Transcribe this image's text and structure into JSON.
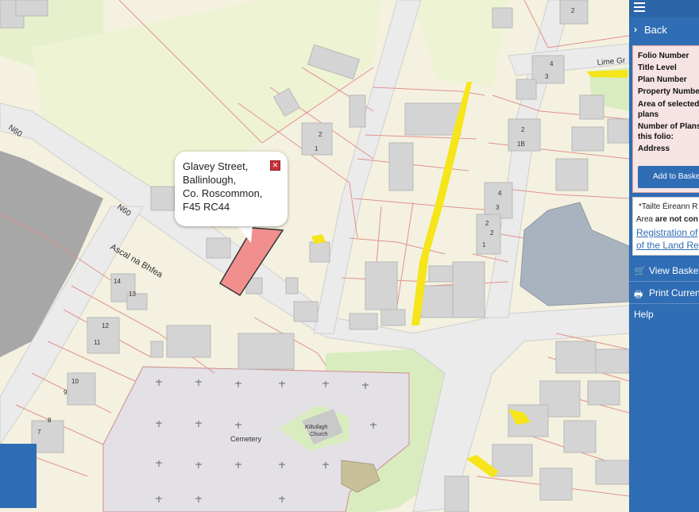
{
  "map": {
    "street_labels": {
      "n60_a": "N60",
      "n60_b": "N60",
      "ascal": "Ascal na Bhfea",
      "lime": "Lime Gr"
    },
    "building_labels": {
      "cemetery": "Cemetery",
      "church_line1": "Kiltullagh",
      "church_line2": "Church"
    },
    "house_numbers": [
      "2",
      "4",
      "3",
      "2",
      "1",
      "2",
      "1B",
      "4",
      "3",
      "2",
      "2",
      "1",
      "14",
      "13",
      "12",
      "11",
      "10",
      "9",
      "8",
      "7"
    ],
    "colors": {
      "background": "#f4f1e0",
      "parcel_line": "#e0928c",
      "building": "#d4d4d4",
      "road": "#e8e8e8",
      "selected_parcel": "#f18f8f",
      "highlight": "#f5e51a",
      "cemetery": "#e3e0e6",
      "green": "#d9ecc0"
    }
  },
  "popup": {
    "address_lines": [
      "Glavey Street,",
      "Ballinlough,",
      "Co. Roscommon,",
      "F45 RC44"
    ]
  },
  "sidebar": {
    "back_label": "Back",
    "info_labels": [
      "Folio Number",
      "Title Level",
      "Plan Number",
      "Property Numbe",
      "Area of selected",
      "plans",
      "Number of Plans",
      "this folio:",
      "Address"
    ],
    "add_to_basket_label": "Add to Basket",
    "notice": {
      "line1": "*Tailte Éireann R",
      "line2_prefix": "Area ",
      "line2_bold": "are not con",
      "link_line1": "Registration of",
      "link_line2": "of the Land Reg"
    },
    "view_basket_label": "View Basket",
    "print_label": "Print Curren",
    "help_label": "Help",
    "colors": {
      "panel": "#2f6db4",
      "info_bg": "#f6e3e3"
    }
  }
}
